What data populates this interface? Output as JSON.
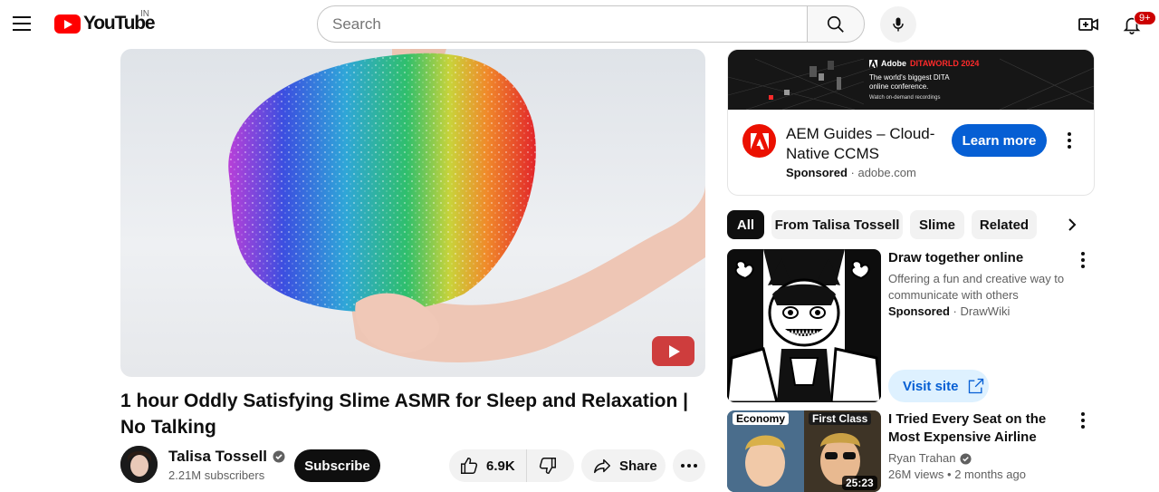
{
  "header": {
    "logo_text": "YouTube",
    "country_code": "IN",
    "search_placeholder": "Search",
    "notification_count": "9+"
  },
  "video": {
    "title": "1 hour Oddly Satisfying Slime ASMR for Sleep and Relaxation | No Talking",
    "channel_name": "Talisa Tossell",
    "subscribers": "2.21M subscribers",
    "subscribe_label": "Subscribe",
    "likes": "6.9K",
    "share_label": "Share"
  },
  "ad": {
    "banner_brand": "Adobe",
    "banner_event": "DITAWORLD 2024",
    "banner_line1": "The world's biggest DITA",
    "banner_line2": "online conference.",
    "banner_line3": "Watch on-demand recordings",
    "title": "AEM Guides – Cloud-Native CCMS",
    "sponsored_label": "Sponsored",
    "domain": "adobe.com",
    "cta_label": "Learn more"
  },
  "chips": [
    "All",
    "From Talisa Tossell",
    "Slime",
    "Related"
  ],
  "sidebar": {
    "sponsored": {
      "title": "Draw together online",
      "description": "Offering a fun and creative way to communicate with others",
      "sponsored_label": "Sponsored",
      "advertiser": "DrawWiki",
      "cta_label": "Visit site"
    },
    "rec1": {
      "title": "I Tried Every Seat on the Most Expensive Airline",
      "channel": "Ryan Trahan",
      "views": "26M views",
      "age": "2 months ago",
      "duration": "25:23",
      "thumb_label_left": "Economy",
      "thumb_label_right": "First Class"
    }
  },
  "colors": {
    "brand_red": "#ff0000",
    "primary_blue": "#065fd4",
    "chip_bg": "#f2f2f2",
    "text": "#0f0f0f",
    "secondary_text": "#606060"
  }
}
